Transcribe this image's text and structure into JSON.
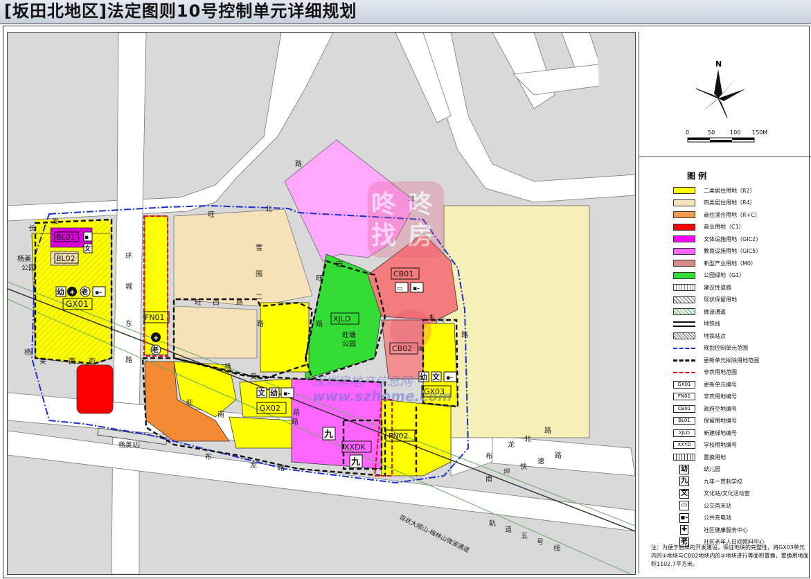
{
  "title": "[坂田北地区]法定图则10号控制单元详细规划",
  "compass": {
    "north": "N",
    "scale_labels": [
      "0",
      "50",
      "100",
      "150M"
    ]
  },
  "legend": {
    "title": "图 例",
    "items": [
      {
        "label": "二类居住用地（R2）",
        "color": "#ffff00"
      },
      {
        "label": "四类居住用地（R4）",
        "color": "#f5e2b8"
      },
      {
        "label": "商住混合用地（R+C）",
        "color": "#f39a4b"
      },
      {
        "label": "商业用地（C1）",
        "color": "#ff0000"
      },
      {
        "label": "文体设施用地（GIC2）",
        "color": "#ff00ff"
      },
      {
        "label": "教育设施用地（GIC5）",
        "color": "#ff66ff"
      },
      {
        "label": "新型产业用地（M0）",
        "color": "#d58c86"
      },
      {
        "label": "公园绿地（G1）",
        "color": "#33dd33"
      },
      {
        "label": "建议性道路"
      },
      {
        "label": "现状保留用地"
      },
      {
        "label": "微波通道"
      },
      {
        "label": "地铁线"
      },
      {
        "label": "地铁站点"
      },
      {
        "label": "规划控制单元范围"
      },
      {
        "label": "更新单元拆除用地范围"
      },
      {
        "label": "非农用地范围"
      },
      {
        "label": "更新单元编号",
        "code": "GX01"
      },
      {
        "label": "非农用地编号",
        "code": "FN01"
      },
      {
        "label": "政府空地编号",
        "code": "CB01"
      },
      {
        "label": "保留用地编号",
        "code": "BL01"
      },
      {
        "label": "新建绿地编号",
        "code": "XJLD"
      },
      {
        "label": "学校用地编号",
        "code": "XXYD"
      },
      {
        "label": "置换用地"
      },
      {
        "label": "幼儿园",
        "icon": "幼"
      },
      {
        "label": "九年一贯制学校",
        "icon": "九"
      },
      {
        "label": "文化站/文化活动室",
        "icon": "文"
      },
      {
        "label": "公交首末站",
        "icon": "bus"
      },
      {
        "label": "公共充电站",
        "icon": "charge"
      },
      {
        "label": "社区健康服务中心",
        "icon": "plus"
      },
      {
        "label": "社区老年人日间照料中心",
        "icon": "老"
      }
    ]
  },
  "note": "注：为便于后续的开发建设，保证地块的完整性，将GX03单元内的①地块与CB02地块内的②地块进行等面积置换，置换用地面积1102.7平方米。",
  "map": {
    "parcel_codes": [
      "BL01",
      "BL02",
      "GX01",
      "FN01",
      "XJLD",
      "CB01",
      "CB02",
      "GX02",
      "GX03",
      "FN02",
      "XXDK"
    ],
    "park_label": [
      "旺塘",
      "公园"
    ],
    "park_yangmei": [
      "杨美",
      "公园"
    ],
    "road_labels": {
      "wangbei": [
        "旺",
        "北",
        "路"
      ],
      "changfa": [
        "长",
        "发"
      ],
      "huancheng": [
        "环",
        "城",
        "东",
        "路"
      ],
      "wangxi": [
        "旺",
        "西",
        "路"
      ],
      "xuewei": [
        "雪",
        "围",
        "二",
        "路"
      ],
      "xinwang": [
        "宏",
        "旺",
        "路"
      ],
      "longxi": [
        "龙",
        "路"
      ],
      "bulong": [
        "布",
        "龙",
        "路"
      ],
      "bulongbei": [
        "布",
        "龙",
        "北",
        "路"
      ],
      "nanping": [
        "南",
        "坪",
        "快",
        "速",
        "路"
      ],
      "yangmei_road": [
        "杨",
        "美",
        "路"
      ],
      "wangnan": [
        "旺",
        "南",
        "路"
      ],
      "yangmei2": [
        "杨",
        "美"
      ],
      "xijie": [
        "西",
        "街"
      ],
      "yangmei_station": "杨美站",
      "tunnel": "现状大顺山-梅林山微波通道",
      "metro5": [
        "轨",
        "道",
        "五",
        "号",
        "线"
      ],
      "lu_diag": "路"
    },
    "watermark": {
      "top": [
        "咚",
        "咚"
      ],
      "bottom": [
        "找",
        "房"
      ],
      "url": "www.szhome.com",
      "site": "深圳房地产信息网"
    },
    "marker_circled": "①",
    "marker_circled2": "②"
  }
}
